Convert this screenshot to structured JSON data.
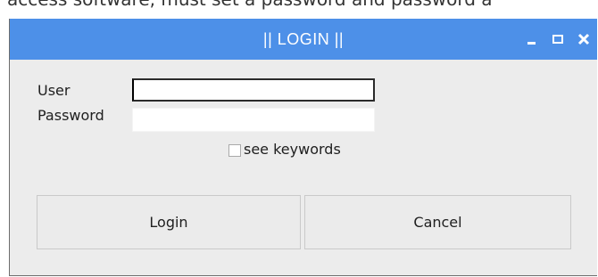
{
  "background_text": "access software, must set a password and password a",
  "window": {
    "title": "|| LOGIN ||",
    "controls": {
      "minimize_icon": "minimize-icon",
      "maximize_icon": "maximize-icon",
      "close_icon": "close-icon"
    },
    "titlebar_color": "#4d90e8"
  },
  "form": {
    "user_label": "User",
    "user_value": "",
    "password_label": "Password",
    "password_value": "",
    "see_keywords_label": "see keywords",
    "see_keywords_checked": false
  },
  "buttons": {
    "login_label": "Login",
    "cancel_label": "Cancel"
  }
}
